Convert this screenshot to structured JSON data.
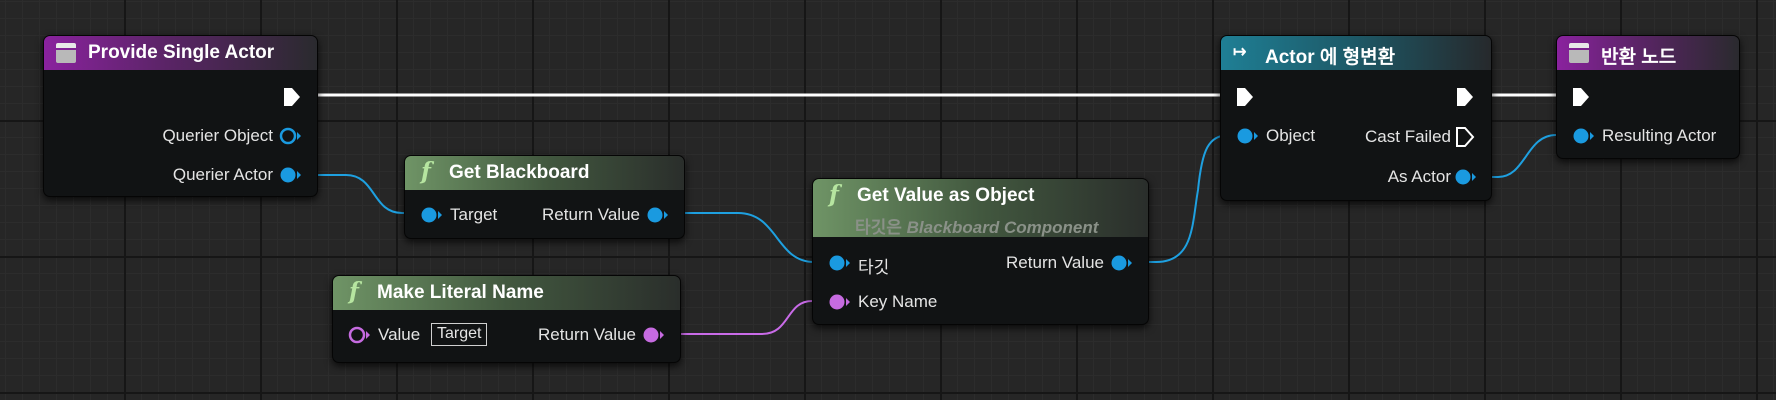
{
  "colors": {
    "exec_wire": "#ffffff",
    "object_wire": "#1ea0e0",
    "name_wire": "#c96be8",
    "object_pin": "#1a9ae0",
    "name_pin": "#c66be0"
  },
  "nodes": {
    "provide": {
      "title": "Provide Single Actor",
      "icon": "box-icon",
      "pins": {
        "querier_object": "Querier Object",
        "querier_actor": "Querier Actor"
      }
    },
    "get_blackboard": {
      "title": "Get Blackboard",
      "icon": "function-icon",
      "pins": {
        "target": "Target",
        "return_value": "Return Value"
      }
    },
    "make_literal": {
      "title": "Make Literal Name",
      "icon": "function-icon",
      "pins": {
        "value": "Value",
        "value_default": "Target",
        "return_value": "Return Value"
      }
    },
    "get_value": {
      "title": "Get Value as Object",
      "subtitle_prefix": "타깃은",
      "subtitle_class": "Blackboard Component",
      "icon": "function-icon",
      "pins": {
        "target": "타깃",
        "key_name": "Key Name",
        "return_value": "Return Value"
      }
    },
    "cast": {
      "title": "Actor 에 형변환",
      "icon": "cast-icon",
      "pins": {
        "object": "Object",
        "cast_failed": "Cast Failed",
        "as_actor": "As Actor"
      }
    },
    "return": {
      "title": "반환 노드",
      "icon": "box-icon",
      "pins": {
        "resulting_actor": "Resulting Actor"
      }
    }
  }
}
